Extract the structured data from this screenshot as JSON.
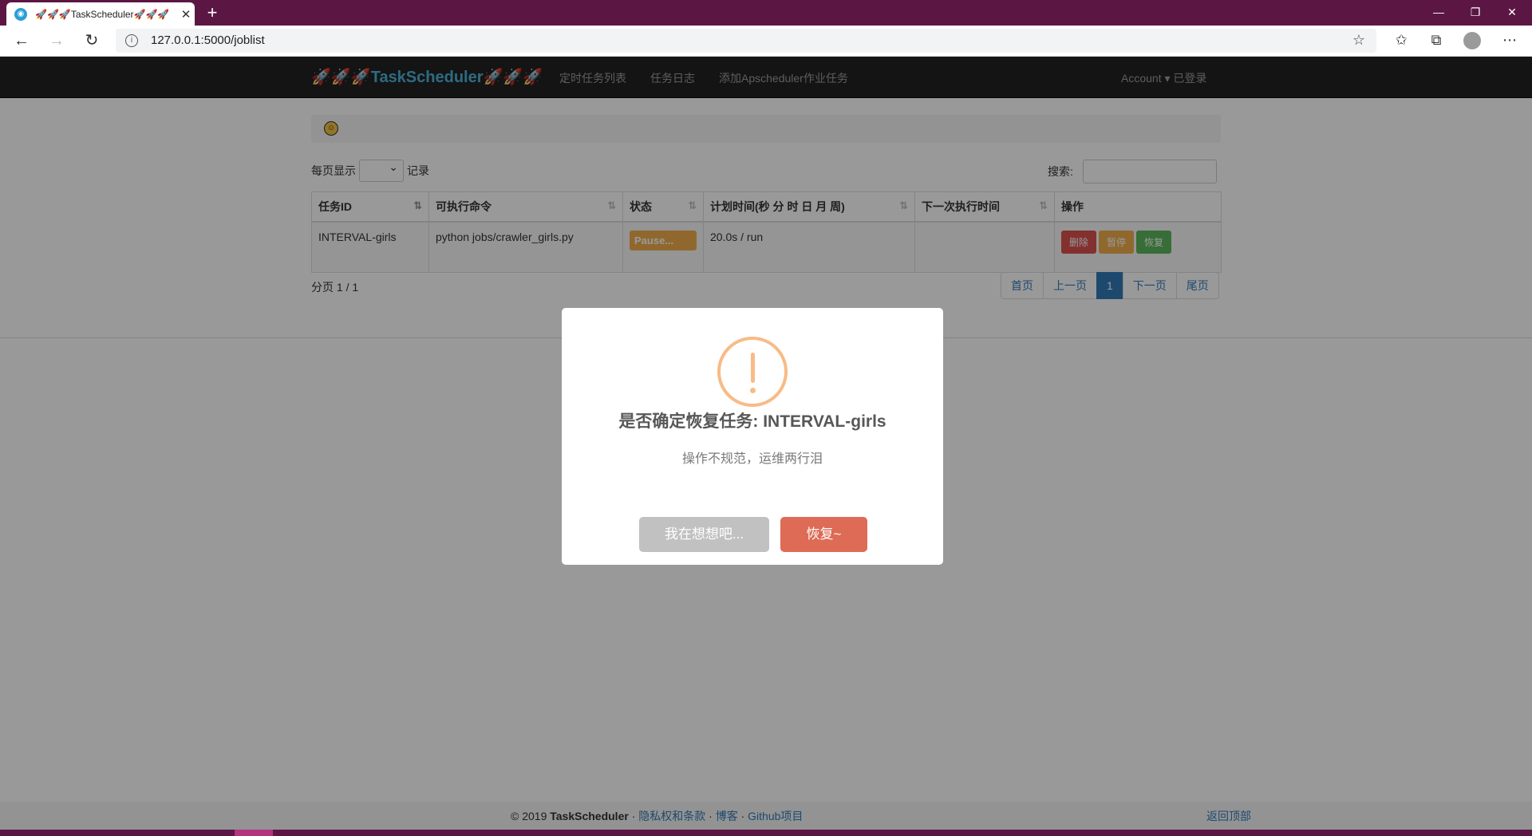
{
  "browser": {
    "tab_title": "🚀🚀🚀TaskScheduler🚀🚀🚀",
    "url": "127.0.0.1:5000/joblist"
  },
  "navbar": {
    "brand": "🚀🚀🚀TaskScheduler🚀🚀🚀",
    "links": [
      "定时任务列表",
      "任务日志",
      "添加Apscheduler作业任务"
    ],
    "account": "Account ▾ 已登录"
  },
  "table_controls": {
    "length_prefix": "每页显示",
    "length_suffix": "记录",
    "search_label": "搜索:"
  },
  "table": {
    "headers": [
      "任务ID",
      "可执行命令",
      "状态",
      "计划时间(秒 分 时 日 月 周)",
      "下一次执行时间",
      "操作"
    ],
    "rows": [
      {
        "id": "INTERVAL-girls",
        "command": "python jobs/crawler_girls.py",
        "status": "Pause...",
        "schedule": "20.0s / run",
        "next_run": "",
        "actions": [
          "删除",
          "暂停",
          "恢复"
        ]
      }
    ]
  },
  "pagination": {
    "info": "分页 1 / 1",
    "first": "首页",
    "prev": "上一页",
    "current": "1",
    "next": "下一页",
    "last": "尾页"
  },
  "footer": {
    "copyright": "© 2019 ",
    "brand": "TaskScheduler",
    "sep": " · ",
    "privacy": "隐私权和条款",
    "blog": "博客",
    "github": "Github项目",
    "back_to_top": "返回顶部"
  },
  "modal": {
    "title": "是否确定恢复任务: INTERVAL-girls",
    "text": "操作不规范，运维两行泪",
    "cancel": "我在想想吧...",
    "confirm": "恢复~",
    "colors": {
      "cancel": "#c1c1c1",
      "confirm": "#dd6b55",
      "warning": "#f8bb86"
    }
  },
  "colors": {
    "tabstrip": "#5c1644",
    "navbar": "#222222",
    "brand": "#4cb4d8",
    "danger": "#d9534f",
    "warning": "#f0ad4e",
    "success": "#5cb85c",
    "primary": "#337ab7"
  }
}
